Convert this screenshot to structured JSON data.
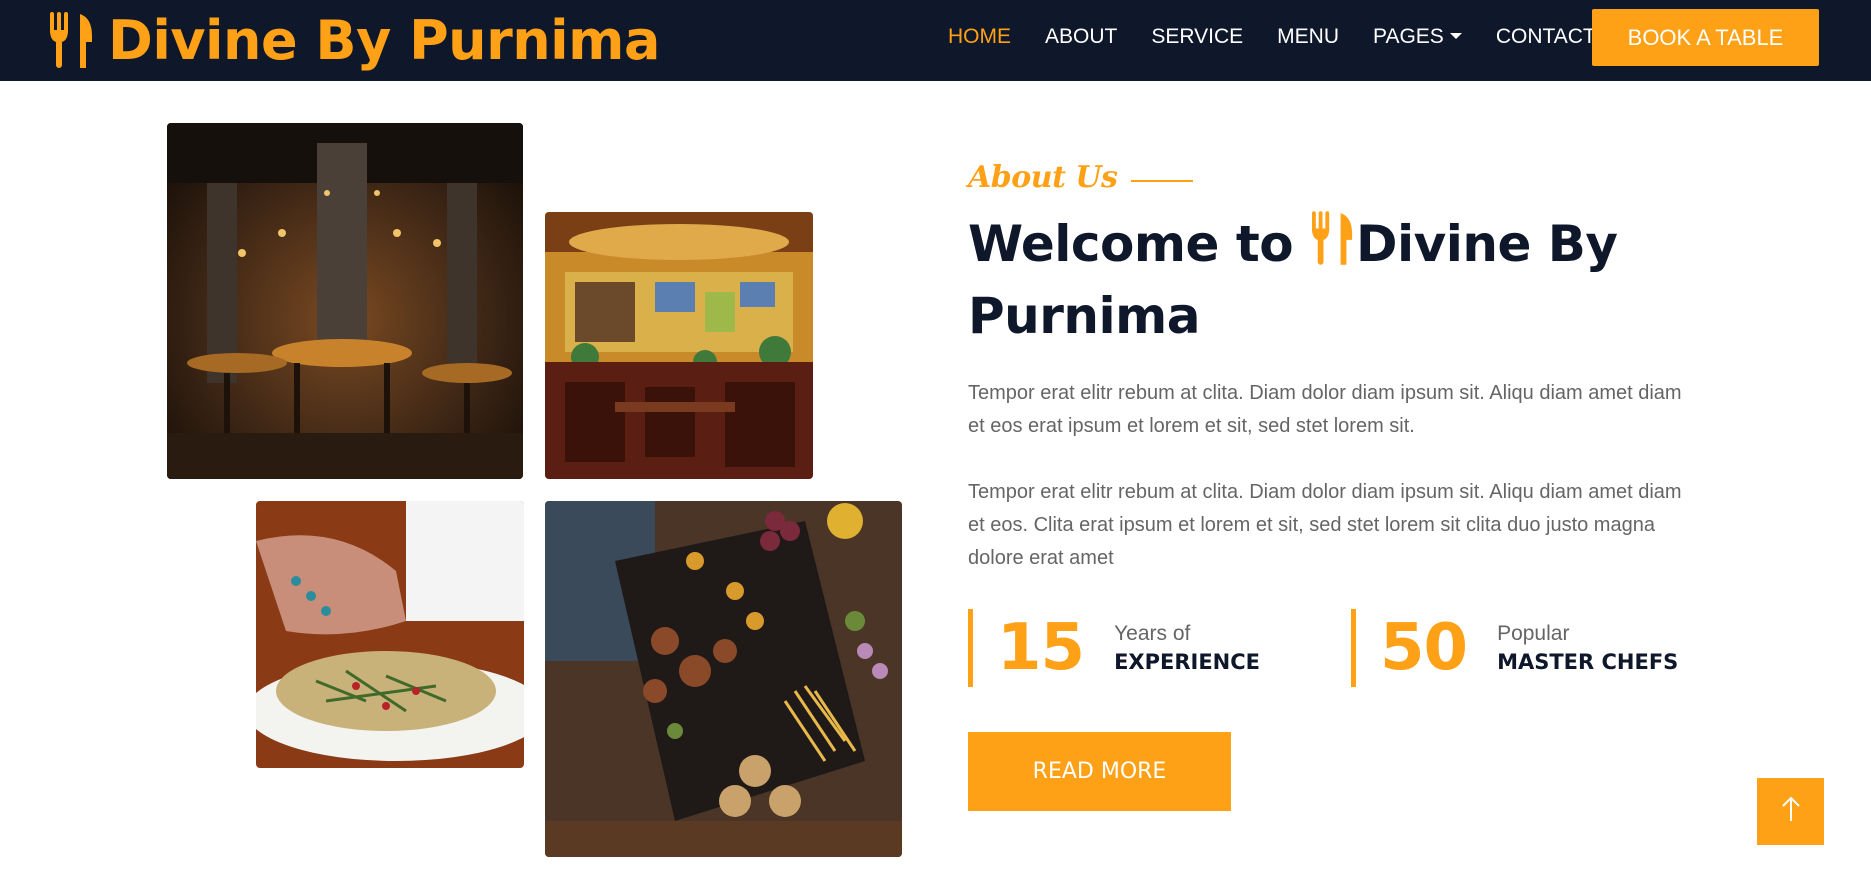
{
  "brand": {
    "name": "Divine By Purnima",
    "icon": "utensils-icon"
  },
  "nav": {
    "items": [
      {
        "label": "HOME",
        "active": true
      },
      {
        "label": "ABOUT",
        "active": false
      },
      {
        "label": "SERVICE",
        "active": false
      },
      {
        "label": "MENU",
        "active": false
      },
      {
        "label": "PAGES",
        "active": false,
        "dropdown": true
      },
      {
        "label": "CONTACT",
        "active": false
      }
    ],
    "cta": "BOOK A TABLE"
  },
  "gallery": [
    {
      "name": "restaurant-interior-photo"
    },
    {
      "name": "restaurant-bar-photo"
    },
    {
      "name": "salad-plate-photo"
    },
    {
      "name": "food-platter-photo"
    }
  ],
  "about": {
    "label": "About Us",
    "heading_pre": "Welcome to",
    "heading_brand": "Divine By Purnima",
    "para1": "Tempor erat elitr rebum at clita. Diam dolor diam ipsum sit. Aliqu diam amet diam et eos erat ipsum et lorem et sit, sed stet lorem sit.",
    "para2": "Tempor erat elitr rebum at clita. Diam dolor diam ipsum sit. Aliqu diam amet diam et eos. Clita erat ipsum et lorem et sit, sed stet lorem sit clita duo justo magna dolore erat amet",
    "stats": [
      {
        "number": "15",
        "small": "Years of",
        "big": "EXPERIENCE"
      },
      {
        "number": "50",
        "small": "Popular",
        "big": "MASTER CHEFS"
      }
    ],
    "button": "READ MORE"
  },
  "back_to_top": {
    "icon": "arrow-up-icon"
  },
  "colors": {
    "primary": "#fea116",
    "dark": "#0f172b",
    "text": "#666565"
  }
}
